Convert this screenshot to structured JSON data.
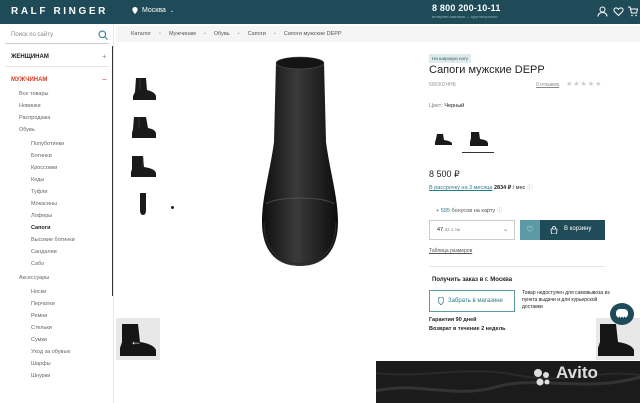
{
  "header": {
    "logo": "RALF RINGER",
    "city": "Москва",
    "phone": "8 800 200-10-11",
    "phone_note": "интернет-магазин — круглосуточно"
  },
  "sidebar": {
    "search_placeholder": "Поиск по сайту",
    "women": "ЖЕНЩИНАМ",
    "men": "МУЖЧИНАМ",
    "plus": "+",
    "minus": "−",
    "men_items": [
      "Все товары",
      "Новинки",
      "Распродажа",
      "Обувь"
    ],
    "shoe_items": [
      "Полуботинки",
      "Ботинки",
      "Кроссовки",
      "Кеды",
      "Туфли",
      "Мокасины",
      "Лоферы",
      "Сапоги",
      "Высокие ботинки",
      "Сандалии",
      "Сабо"
    ],
    "accessories": "Аксессуары",
    "acc_items": [
      "Носки",
      "Перчатки",
      "Ремни",
      "Стельки",
      "Сумки",
      "Уход за обувью",
      "Шарфы",
      "Шнурки"
    ]
  },
  "breadcrumb": [
    "Каталог",
    "Мужчинам",
    "Обувь",
    "Сапоги",
    "Сапоги мужские DEPP"
  ],
  "product": {
    "badge": "На широкую ногу",
    "title": "Сапоги мужские DEPP",
    "article": "590302ЧНБ",
    "reviews": "0 отзывов",
    "stars": "★★★★★",
    "color_label": "Цвет:",
    "color_value": "Черный",
    "price": "8 500 ₽",
    "installment_link": "В рассрочку на 3 месяца",
    "installment_value": "2834 ₽",
    "installment_unit": "/ мес",
    "bonus_points": "+ 595",
    "bonus_text": "бонусов на карту",
    "size": "47",
    "size_cm": "32.1 см",
    "cart": "В корзину",
    "size_table": "Таблица размеров",
    "pickup_title": "Получить заказ в г. Москва",
    "store_button": "Забрать в магазине",
    "unavailable": "Товар недоступен для самовывоза из пункта выдачи и для курьерской доставки",
    "guarantee": "Гарантия 90 дней",
    "return_policy": "Возврат в течение 2 недель"
  },
  "watermark": "Avito",
  "colors": {
    "brand": "#1f4a57",
    "accent": "#5c9aa6",
    "sale_red": "#d53c26"
  }
}
